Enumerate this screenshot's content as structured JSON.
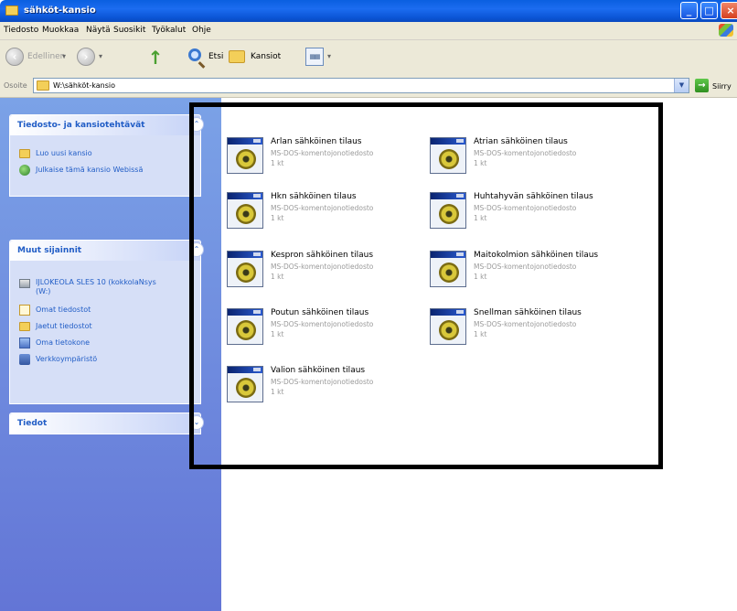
{
  "window": {
    "title": "sähköt-kansio"
  },
  "menu": [
    "Tiedosto",
    "Muokkaa",
    "Näytä",
    "Suosikit",
    "Työkalut",
    "Ohje"
  ],
  "toolbar": {
    "back_label": "Edellinen",
    "search_label": "Etsi",
    "folders_label": "Kansiot"
  },
  "address": {
    "label": "Osoite",
    "path": "W:\\sähköt-kansio",
    "go_label": "Siirry"
  },
  "task_pane": {
    "file_tasks": {
      "title": "Tiedosto- ja kansiotehtävät",
      "items": [
        "Luo uusi kansio",
        "Julkaise tämä kansio Webissä"
      ]
    },
    "other_places": {
      "title": "Muut sijainnit",
      "items": [
        "IJLOKEOLA SLES 10 (kokkolaNsys (W:)",
        "Omat tiedostot",
        "Jaetut tiedostot",
        "Oma tietokone",
        "Verkkoympäristö"
      ]
    },
    "details": {
      "title": "Tiedot"
    }
  },
  "files": [
    {
      "name": "Arlan sähköinen tilaus",
      "type": "MS-DOS-komentojonotiedosto",
      "size": "1 kt"
    },
    {
      "name": "Atrian sähköinen tilaus",
      "type": "MS-DOS-komentojonotiedosto",
      "size": "1 kt"
    },
    {
      "name": "Hkn sähköinen tilaus",
      "type": "MS-DOS-komentojonotiedosto",
      "size": "1 kt"
    },
    {
      "name": "Huhtahyvän sähköinen tilaus",
      "type": "MS-DOS-komentojonotiedosto",
      "size": "1 kt"
    },
    {
      "name": "Kespron sähköinen tilaus",
      "type": "MS-DOS-komentojonotiedosto",
      "size": "1 kt"
    },
    {
      "name": "Maitokolmion sähköinen tilaus",
      "type": "MS-DOS-komentojonotiedosto",
      "size": "1 kt"
    },
    {
      "name": "Poutun sähköinen tilaus",
      "type": "MS-DOS-komentojonotiedosto",
      "size": "1 kt"
    },
    {
      "name": "Snellman sähköinen tilaus",
      "type": "MS-DOS-komentojonotiedosto",
      "size": "1 kt"
    },
    {
      "name": "Valion sähköinen tilaus",
      "type": "MS-DOS-komentojonotiedosto",
      "size": "1 kt"
    }
  ]
}
